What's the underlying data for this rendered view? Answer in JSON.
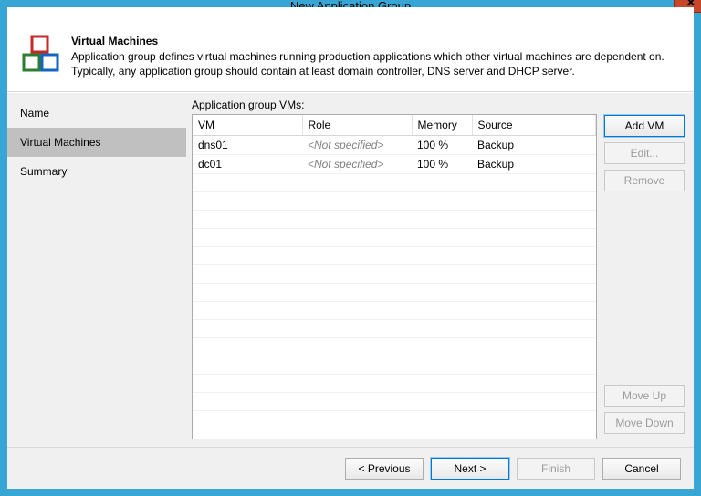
{
  "title": "New Application Group",
  "close": "✕",
  "header": {
    "heading": "Virtual Machines",
    "description": "Application group defines virtual machines running production applications which other virtual machines are dependent on. Typically, any application group should contain at least domain controller, DNS server and DHCP server."
  },
  "sidebar": {
    "items": [
      {
        "label": "Name",
        "active": false
      },
      {
        "label": "Virtual Machines",
        "active": true
      },
      {
        "label": "Summary",
        "active": false
      }
    ]
  },
  "main": {
    "table_label": "Application group VMs:",
    "columns": {
      "vm": "VM",
      "role": "Role",
      "memory": "Memory",
      "source": "Source"
    },
    "not_specified": "<Not specified>",
    "rows": [
      {
        "vm": "dns01",
        "role": null,
        "memory": "100 %",
        "source": "Backup"
      },
      {
        "vm": "dc01",
        "role": null,
        "memory": "100 %",
        "source": "Backup"
      }
    ]
  },
  "actions": {
    "add": "Add VM",
    "edit": "Edit...",
    "remove": "Remove",
    "move_up": "Move Up",
    "move_down": "Move Down"
  },
  "footer": {
    "previous": "< Previous",
    "next": "Next >",
    "finish": "Finish",
    "cancel": "Cancel"
  }
}
